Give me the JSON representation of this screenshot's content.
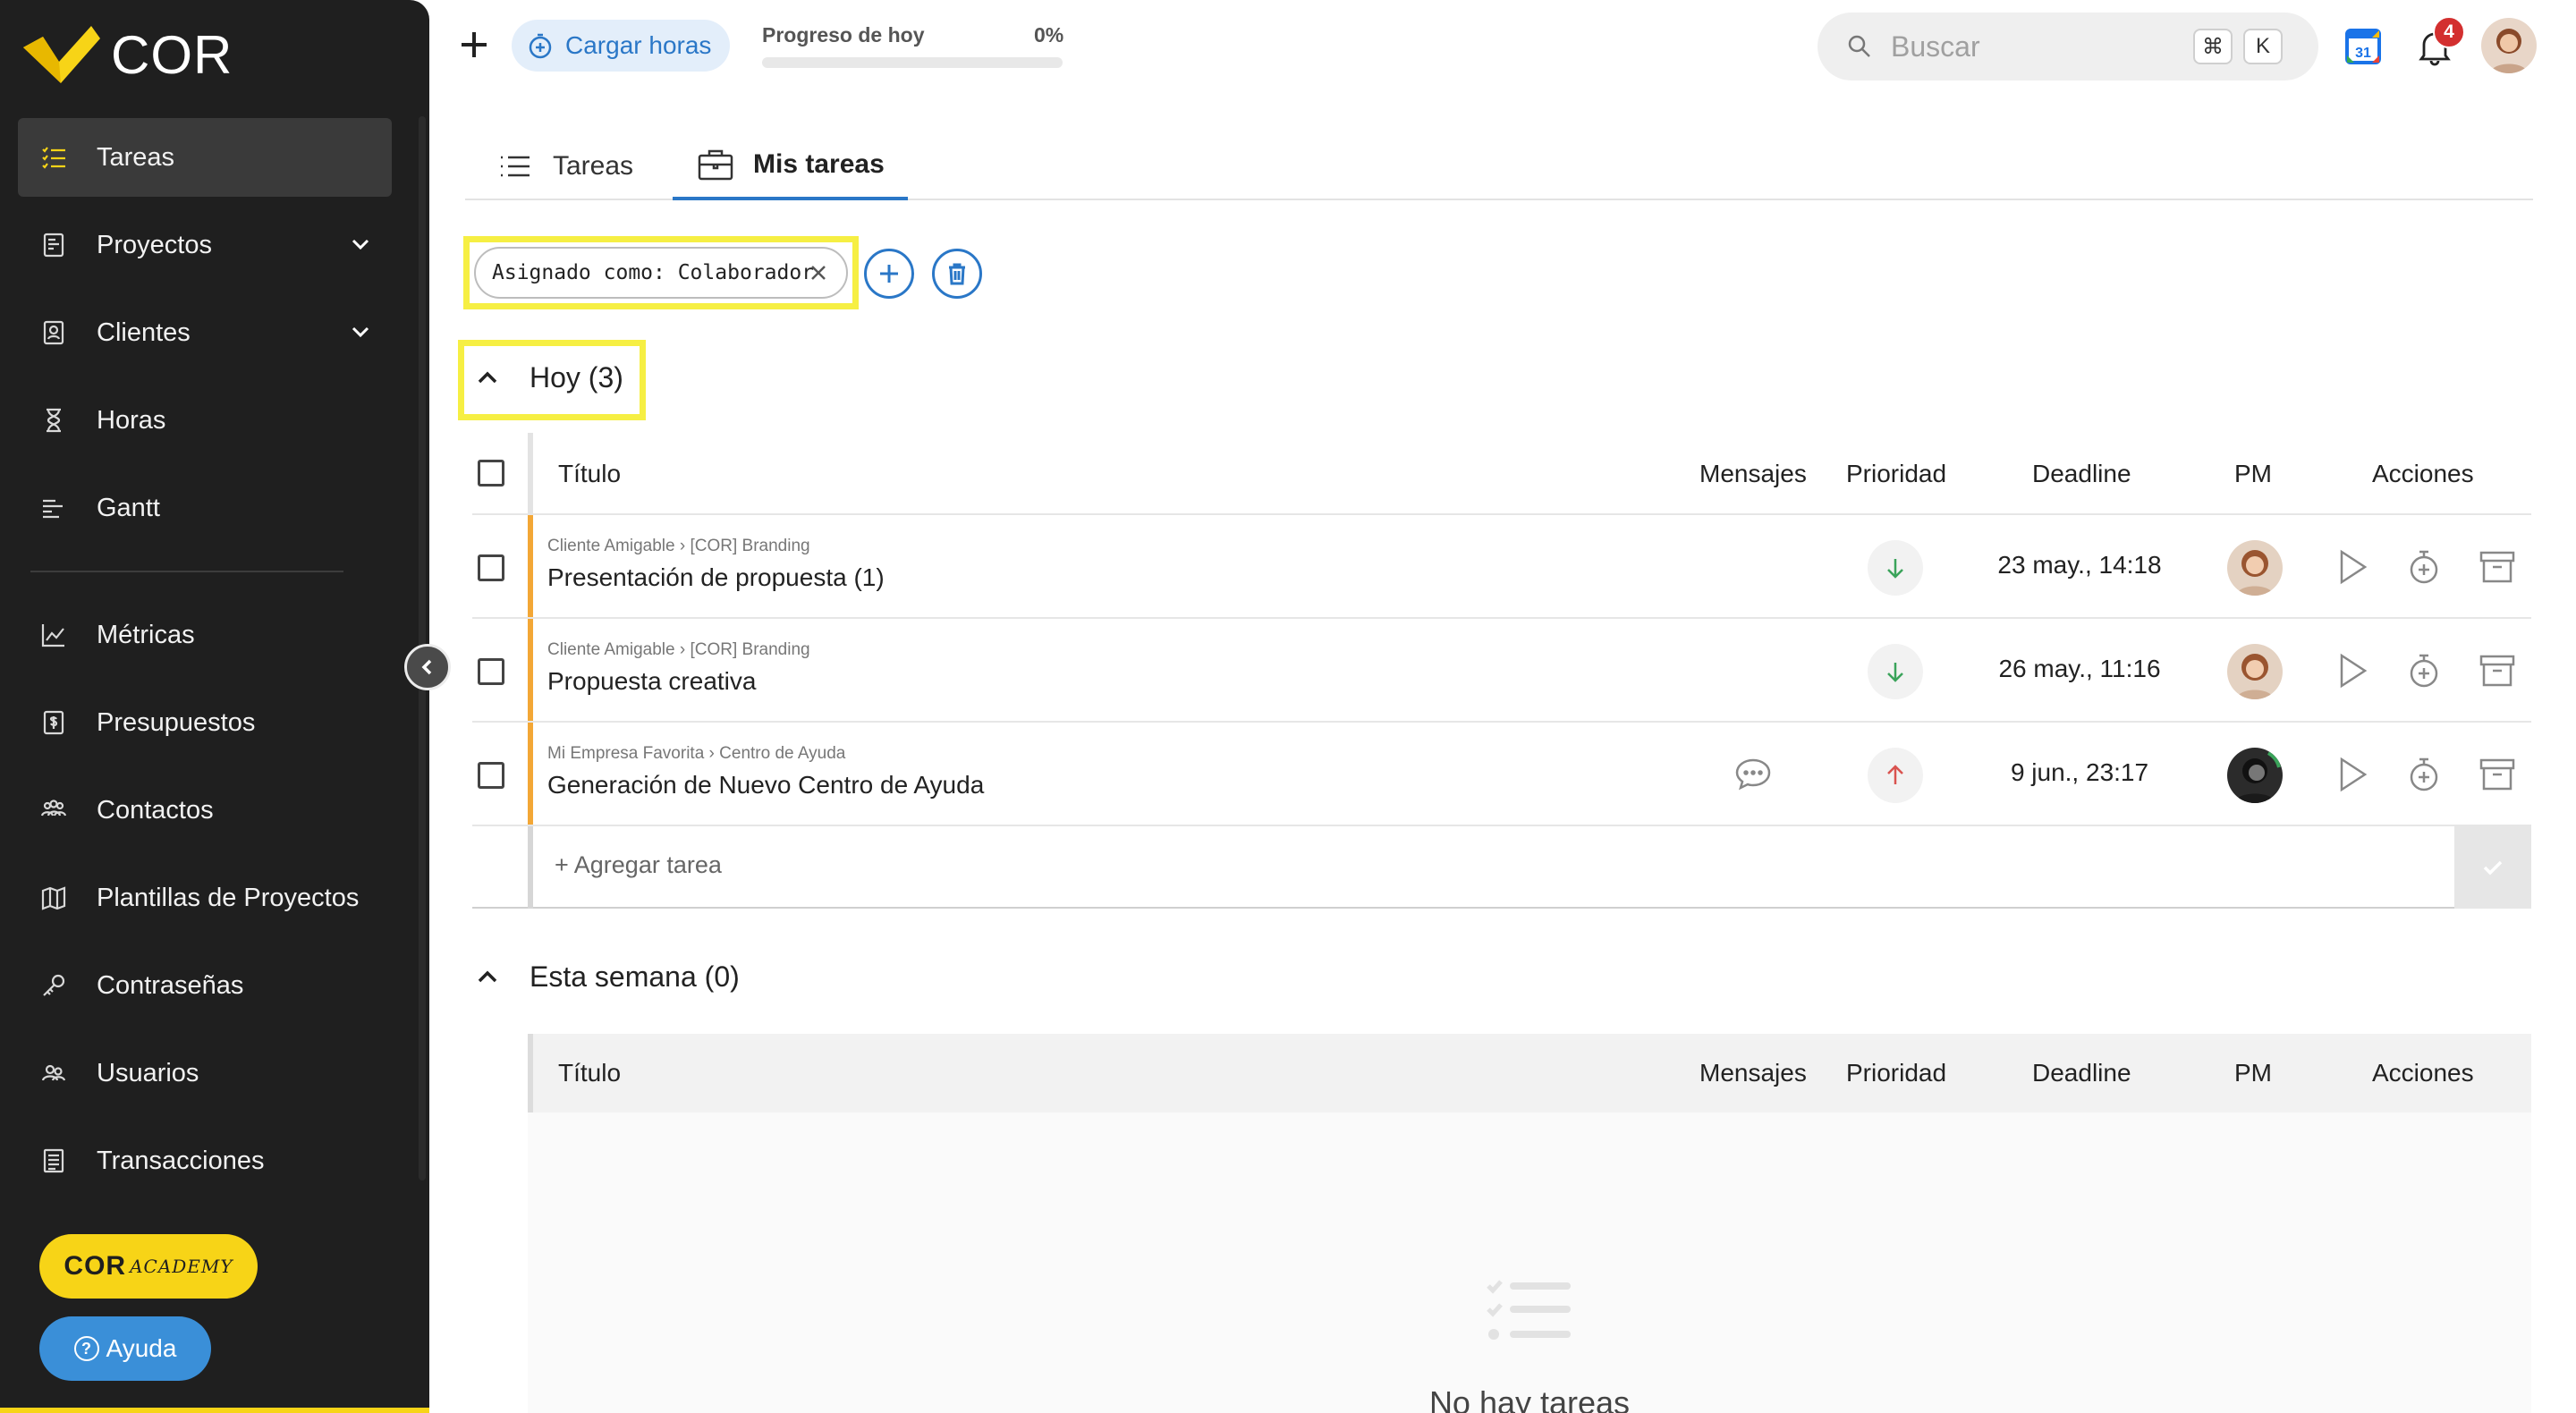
{
  "app": {
    "brand": "COR",
    "accent": "#f7d417",
    "blue": "#2a77c7",
    "accent_bar": "#f3a736"
  },
  "sidebar": {
    "items": [
      {
        "label": "Tareas",
        "icon": "checklist-icon",
        "active": true
      },
      {
        "label": "Proyectos",
        "icon": "folder-icon",
        "expandable": true
      },
      {
        "label": "Clientes",
        "icon": "contact-card-icon",
        "expandable": true
      },
      {
        "label": "Horas",
        "icon": "hourglass-icon"
      },
      {
        "label": "Gantt",
        "icon": "gantt-icon"
      },
      {
        "label": "Métricas",
        "icon": "chart-icon"
      },
      {
        "label": "Presupuestos",
        "icon": "budget-icon"
      },
      {
        "label": "Contactos",
        "icon": "people-icon"
      },
      {
        "label": "Plantillas de Proyectos",
        "icon": "map-icon"
      },
      {
        "label": "Contraseñas",
        "icon": "key-icon"
      },
      {
        "label": "Usuarios",
        "icon": "users-icon"
      },
      {
        "label": "Transacciones",
        "icon": "receipt-icon"
      }
    ],
    "academy_main": "COR",
    "academy_sub": "ACADEMY",
    "help_label": "Ayuda"
  },
  "topbar": {
    "cargar_label": "Cargar horas",
    "progress_label": "Progreso de hoy",
    "progress_value": "0%",
    "progress_fraction": 0,
    "search_placeholder": "Buscar",
    "kbd_cmd": "⌘",
    "kbd_k": "K",
    "calendar_day": "31",
    "notifications": "4"
  },
  "tabs": [
    {
      "label": "Tareas",
      "active": false
    },
    {
      "label": "Mis tareas",
      "active": true
    }
  ],
  "filter": {
    "chip": "Asignado como: Colaborador"
  },
  "columns": {
    "title": "Título",
    "messages": "Mensajes",
    "priority": "Prioridad",
    "deadline": "Deadline",
    "pm": "PM",
    "actions": "Acciones"
  },
  "today": {
    "heading": "Hoy (3)",
    "tasks": [
      {
        "breadcrumb": "Cliente Amigable › [COR] Branding",
        "title": "Presentación de propuesta (1)",
        "priority": "low",
        "deadline": "23 may., 14:18",
        "has_messages": false
      },
      {
        "breadcrumb": "Cliente Amigable › [COR] Branding",
        "title": "Propuesta creativa",
        "priority": "low",
        "deadline": "26 may., 11:16",
        "has_messages": false
      },
      {
        "breadcrumb": "Mi Empresa Favorita › Centro de Ayuda",
        "title": "Generación de Nuevo Centro de Ayuda",
        "priority": "high",
        "deadline": "9 jun., 23:17",
        "has_messages": true
      }
    ],
    "add_placeholder": "+ Agregar tarea"
  },
  "week": {
    "heading": "Esta semana (0)",
    "empty_message": "No hay tareas"
  }
}
